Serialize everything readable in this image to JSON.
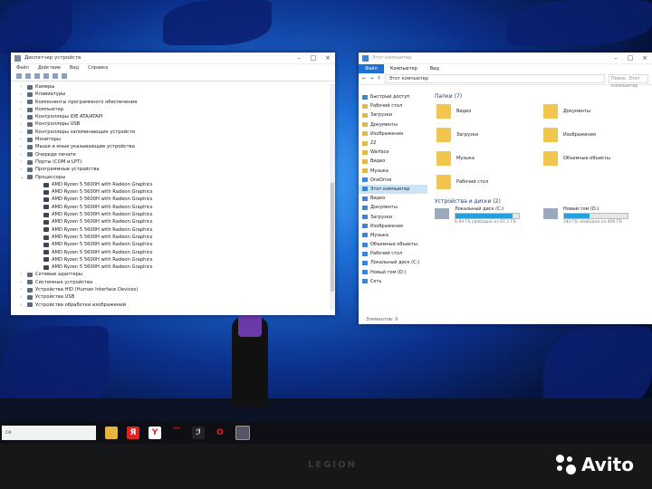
{
  "device_manager": {
    "title": "Диспетчер устройств",
    "menu": [
      "Файл",
      "Действие",
      "Вид",
      "Справка"
    ],
    "categories": [
      "Камеры",
      "Клавиатуры",
      "Компоненты программного обеспечения",
      "Компьютер",
      "Контроллеры IDE ATA/ATAPI",
      "Контроллеры USB",
      "Контроллеры запоминающих устройств",
      "Мониторы",
      "Мыши и иные указывающие устройства",
      "Очереди печати",
      "Порты (COM и LPT)",
      "Программные устройства",
      "Процессоры"
    ],
    "processors": [
      "AMD Ryzen 5 5600H with Radeon Graphics",
      "AMD Ryzen 5 5600H with Radeon Graphics",
      "AMD Ryzen 5 5600H with Radeon Graphics",
      "AMD Ryzen 5 5600H with Radeon Graphics",
      "AMD Ryzen 5 5600H with Radeon Graphics",
      "AMD Ryzen 5 5600H with Radeon Graphics",
      "AMD Ryzen 5 5600H with Radeon Graphics",
      "AMD Ryzen 5 5600H with Radeon Graphics",
      "AMD Ryzen 5 5600H with Radeon Graphics",
      "AMD Ryzen 5 5600H with Radeon Graphics",
      "AMD Ryzen 5 5600H with Radeon Graphics",
      "AMD Ryzen 5 5600H with Radeon Graphics"
    ],
    "after": [
      "Сетевые адаптеры",
      "Системные устройства",
      "Устройства HID (Human Interface Devices)",
      "Устройства USB",
      "Устройства обработки изображений"
    ]
  },
  "explorer": {
    "title": "Этот компьютер",
    "ribbon": [
      "Файл",
      "Компьютер",
      "Вид"
    ],
    "address": "Этот компьютер",
    "search_placeholder": "Поиск: Этот компьютер",
    "nav": [
      {
        "label": "Быстрый доступ",
        "sel": false
      },
      {
        "label": "Рабочий стол",
        "sel": false
      },
      {
        "label": "Загрузки",
        "sel": false
      },
      {
        "label": "Документы",
        "sel": false
      },
      {
        "label": "Изображения",
        "sel": false
      },
      {
        "label": "22",
        "sel": false
      },
      {
        "label": "Warface",
        "sel": false
      },
      {
        "label": "Видео",
        "sel": false
      },
      {
        "label": "Музыка",
        "sel": false
      },
      {
        "label": "OneDrive",
        "sel": false
      },
      {
        "label": "Этот компьютер",
        "sel": true
      },
      {
        "label": "Видео",
        "sel": false
      },
      {
        "label": "Документы",
        "sel": false
      },
      {
        "label": "Загрузки",
        "sel": false
      },
      {
        "label": "Изображения",
        "sel": false
      },
      {
        "label": "Музыка",
        "sel": false
      },
      {
        "label": "Объемные объекты",
        "sel": false
      },
      {
        "label": "Рабочий стол",
        "sel": false
      },
      {
        "label": "Локальный диск (C:)",
        "sel": false
      },
      {
        "label": "Новый том (D:)",
        "sel": false
      },
      {
        "label": "Сеть",
        "sel": false
      }
    ],
    "folders_header": "Папки (7)",
    "folders": [
      "Видео",
      "Документы",
      "Загрузки",
      "Изображения",
      "Музыка",
      "Объемные объекты",
      "Рабочий стол"
    ],
    "drives_header": "Устройства и диски (2)",
    "drives": [
      {
        "name": "Локальный диск (C:)",
        "free": "6,94 ГБ свободно из 67,1 ГБ",
        "used_fraction": 0.9
      },
      {
        "name": "Новый том (D:)",
        "free": "242 ГБ свободно из 400 ГБ",
        "used_fraction": 0.4
      }
    ],
    "status": "Элементов: 9"
  },
  "taskbar": {
    "search": "ск"
  },
  "watermark": "Avito",
  "bezel_text": "LEGION"
}
